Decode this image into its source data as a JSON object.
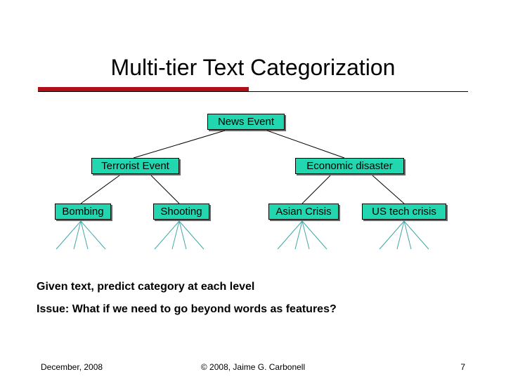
{
  "title": "Multi-tier Text Categorization",
  "tree": {
    "root": "News Event",
    "left": "Terrorist Event",
    "right": "Economic disaster",
    "leaf1": "Bombing",
    "leaf2": "Shooting",
    "leaf3": "Asian Crisis",
    "leaf4": "US tech crisis"
  },
  "body": {
    "line1": "Given text, predict category at each level",
    "line2": "Issue: What if we need to go beyond words as features?"
  },
  "footer": {
    "left": "December, 2008",
    "center": "© 2008, Jaime G. Carbonell",
    "right": "7"
  }
}
